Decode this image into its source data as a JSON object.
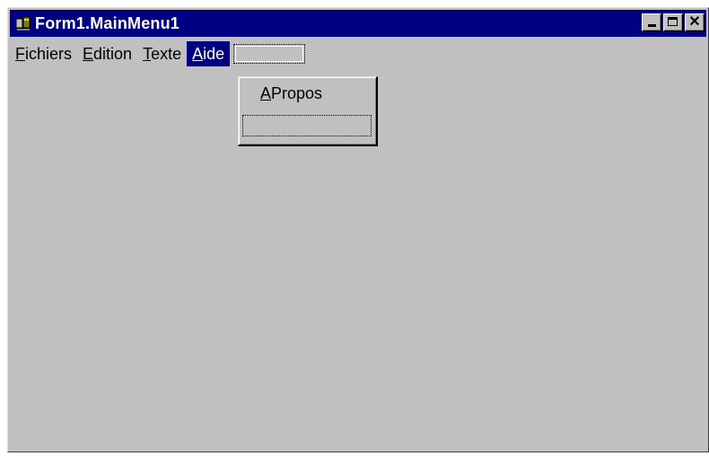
{
  "window": {
    "title": "Form1.MainMenu1",
    "controls": {
      "minimize_icon": "minimize-icon",
      "maximize_icon": "maximize-icon",
      "close_glyph": "✕"
    }
  },
  "menubar": {
    "items": [
      {
        "accel": "F",
        "rest": "ichiers"
      },
      {
        "accel": "E",
        "rest": "dition"
      },
      {
        "accel": "T",
        "rest": "exte"
      },
      {
        "accel": "A",
        "rest": "ide"
      }
    ],
    "active_index": 3
  },
  "dropdown": {
    "items": [
      {
        "accel": "A",
        "rest": "Propos"
      }
    ]
  },
  "colors": {
    "titlebar": "#000080",
    "face": "#c0c0c0",
    "highlight_text": "#ffffff"
  }
}
